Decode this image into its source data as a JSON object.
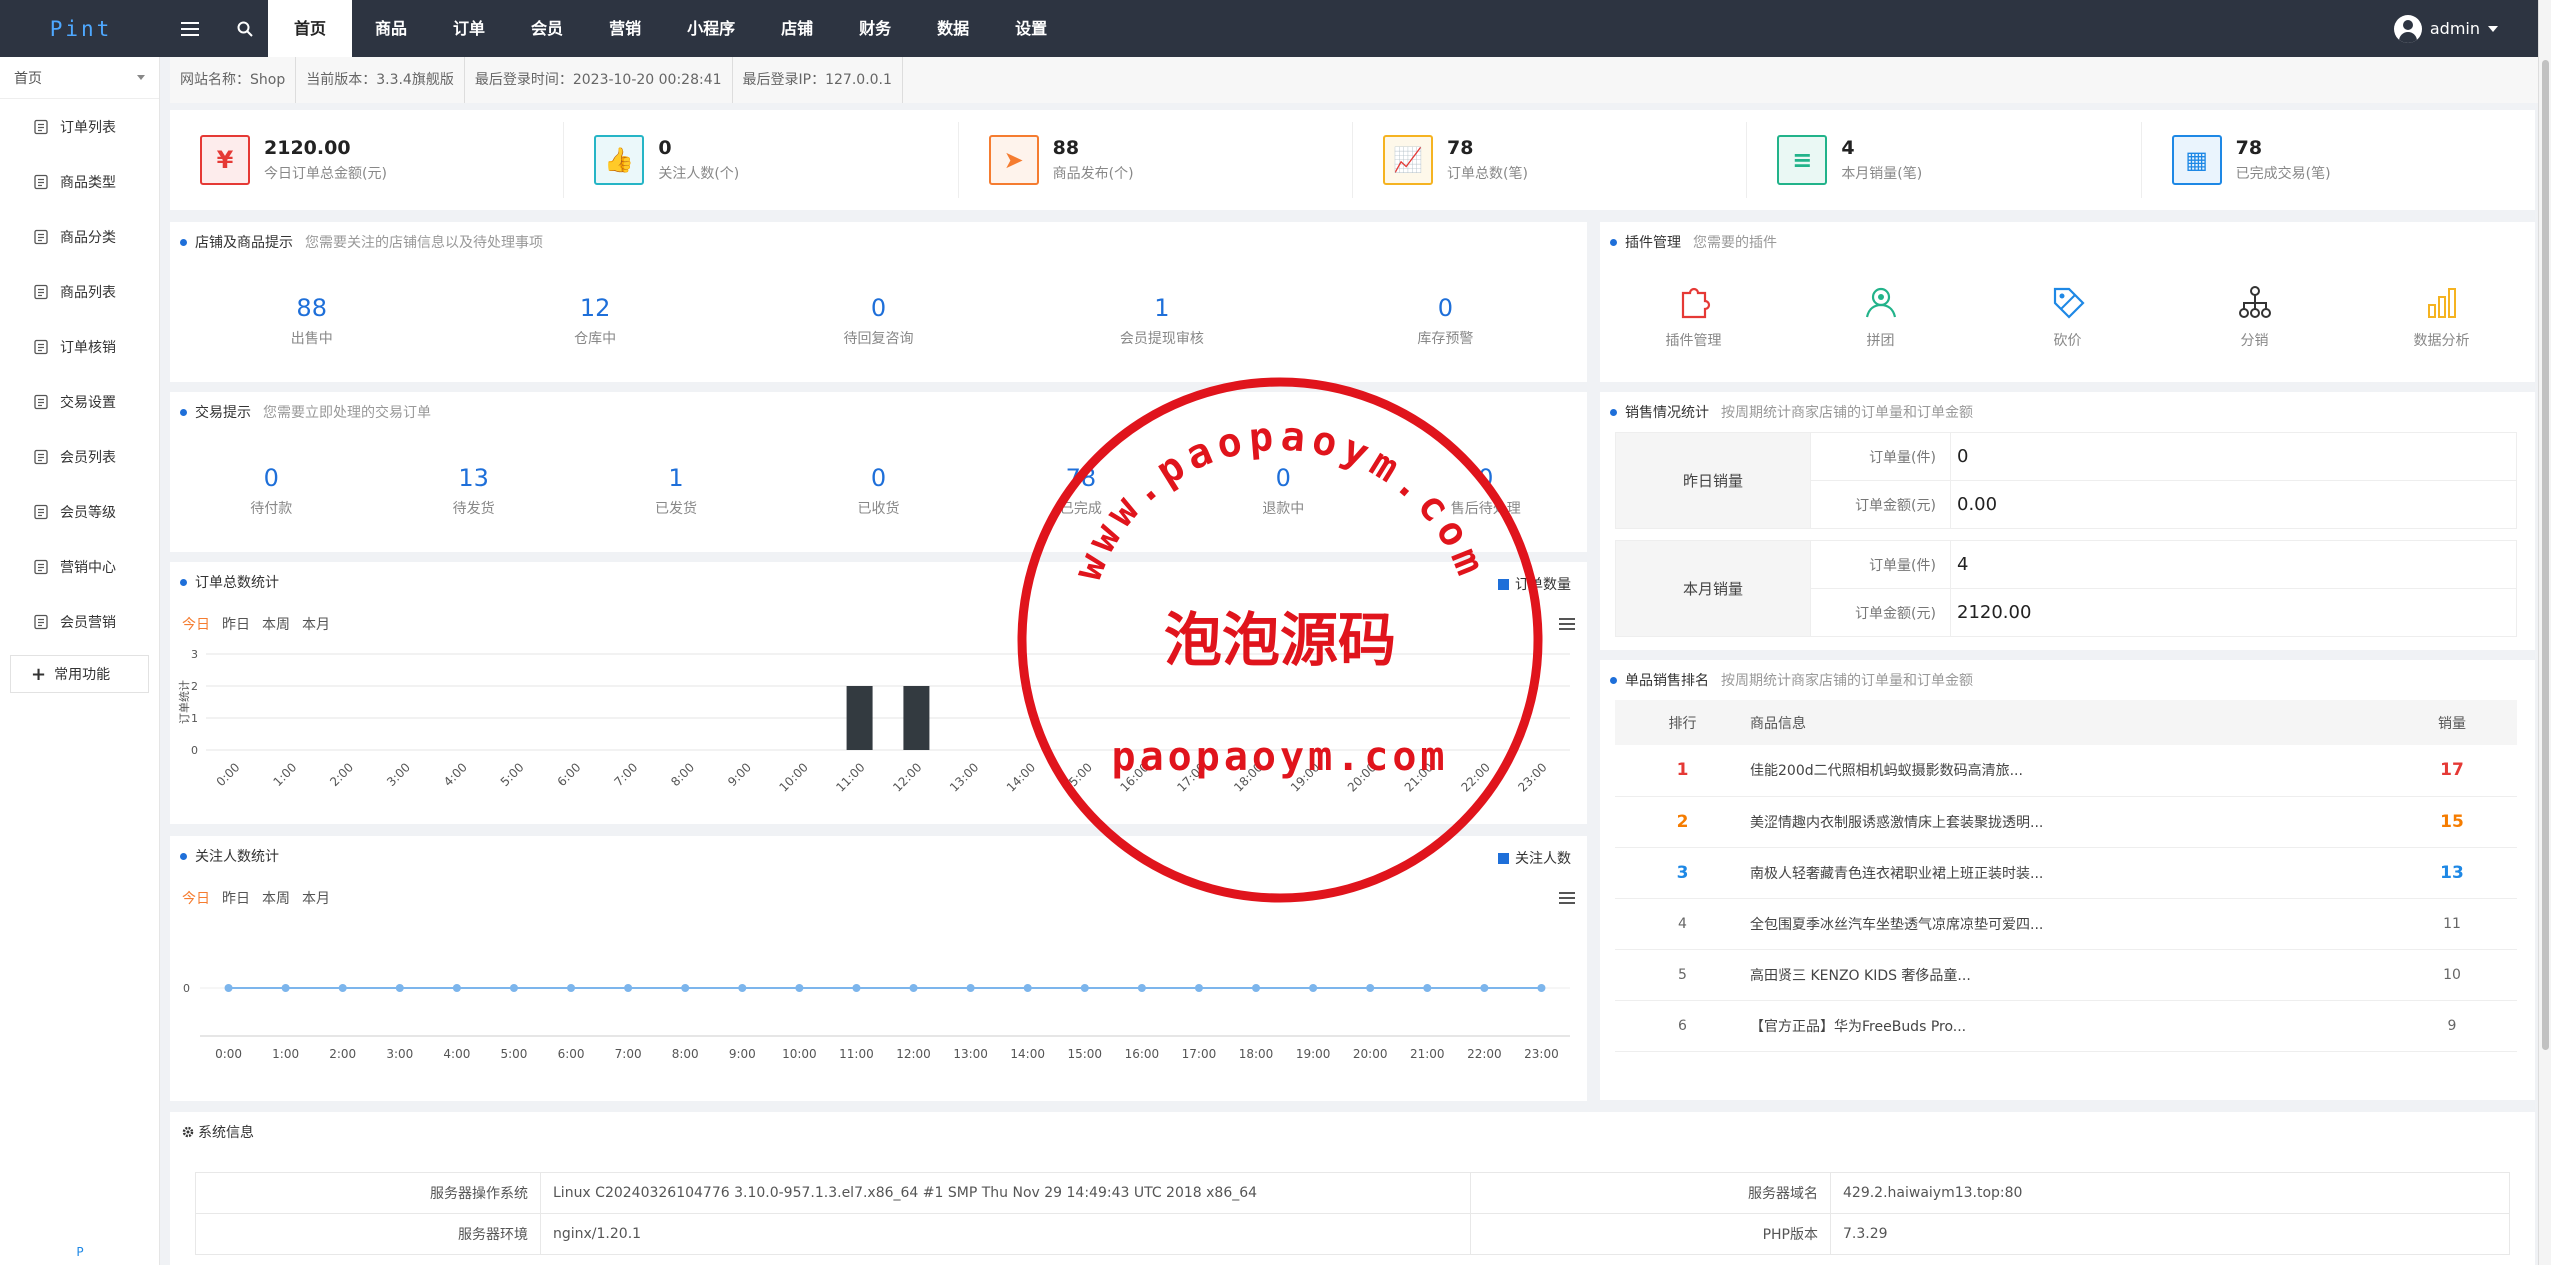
{
  "header": {
    "logo": "Pint",
    "nav": [
      "首页",
      "商品",
      "订单",
      "会员",
      "营销",
      "小程序",
      "店铺",
      "财务",
      "数据",
      "设置"
    ],
    "user": "admin"
  },
  "sidebar": {
    "select": "首页",
    "items": [
      "订单列表",
      "商品类型",
      "商品分类",
      "商品列表",
      "订单核销",
      "交易设置",
      "会员列表",
      "会员等级",
      "营销中心",
      "会员营销"
    ],
    "common": "常用功能",
    "bottom": "P"
  },
  "info": {
    "site": "网站名称：Shop",
    "version": "当前版本：3.3.4旗舰版",
    "last_login": "最后登录时间：2023-10-20 00:28:41",
    "last_ip": "最后登录IP：127.0.0.1"
  },
  "stats": [
    {
      "value": "2120.00",
      "label": "今日订单总金额(元)",
      "color": "#e53935",
      "icon": "yen-icon"
    },
    {
      "value": "0",
      "label": "关注人数(个)",
      "color": "#26b5c6",
      "icon": "thumbs-up-icon"
    },
    {
      "value": "88",
      "label": "商品发布(个)",
      "color": "#f57c30",
      "icon": "paper-plane-icon"
    },
    {
      "value": "78",
      "label": "订单总数(笔)",
      "color": "#f5b321",
      "icon": "trend-chart-icon"
    },
    {
      "value": "4",
      "label": "本月销量(笔)",
      "color": "#22b38a",
      "icon": "clipboard-icon"
    },
    {
      "value": "78",
      "label": "已完成交易(笔)",
      "color": "#1e88e5",
      "icon": "calendar-icon"
    }
  ],
  "store": {
    "title": "店铺及商品提示",
    "subtitle": "您需要关注的店铺信息以及待处理事项",
    "metrics": [
      {
        "value": "88",
        "label": "出售中"
      },
      {
        "value": "12",
        "label": "仓库中"
      },
      {
        "value": "0",
        "label": "待回复咨询"
      },
      {
        "value": "1",
        "label": "会员提现审核"
      },
      {
        "value": "0",
        "label": "库存预警"
      }
    ]
  },
  "trade": {
    "title": "交易提示",
    "subtitle": "您需要立即处理的交易订单",
    "metrics": [
      {
        "value": "0",
        "label": "待付款"
      },
      {
        "value": "13",
        "label": "待发货"
      },
      {
        "value": "1",
        "label": "已发货"
      },
      {
        "value": "0",
        "label": "已收货"
      },
      {
        "value": "78",
        "label": "已完成"
      },
      {
        "value": "0",
        "label": "退款中"
      },
      {
        "value": "0",
        "label": "售后待处理"
      }
    ]
  },
  "plugins": {
    "title": "插件管理",
    "subtitle": "您需要的插件",
    "items": [
      {
        "label": "插件管理",
        "color": "#e53935",
        "icon": "puzzle-icon"
      },
      {
        "label": "拼团",
        "color": "#22b38a",
        "icon": "group-icon"
      },
      {
        "label": "砍价",
        "color": "#1e88e5",
        "icon": "price-tag-icon"
      },
      {
        "label": "分销",
        "color": "#333333",
        "icon": "distribution-icon"
      },
      {
        "label": "数据分析",
        "color": "#f5b321",
        "icon": "bar-chart-icon"
      }
    ]
  },
  "sales": {
    "title": "销售情况统计",
    "subtitle": "按周期统计商家店铺的订单量和订单金额",
    "groups": [
      {
        "name": "昨日销量",
        "rows": [
          {
            "label": "订单量(件)",
            "value": "0"
          },
          {
            "label": "订单金额(元)",
            "value": "0.00"
          }
        ]
      },
      {
        "name": "本月销量",
        "rows": [
          {
            "label": "订单量(件)",
            "value": "4"
          },
          {
            "label": "订单金额(元)",
            "value": "2120.00"
          }
        ]
      }
    ]
  },
  "ranking": {
    "title": "单品销售排名",
    "subtitle": "按周期统计商家店铺的订单量和订单金额",
    "headers": [
      "排行",
      "商品信息",
      "销量"
    ],
    "rows": [
      {
        "rank": "1",
        "name": "佳能200d二代照相机蚂蚁摄影数码高清旅...",
        "sales": "17",
        "color": "#e53935"
      },
      {
        "rank": "2",
        "name": "美涩情趣内衣制服诱惑激情床上套装聚拢透明...",
        "sales": "15",
        "color": "#f57c00"
      },
      {
        "rank": "3",
        "name": "南极人轻奢藏青色连衣裙职业裙上班正装时装...",
        "sales": "13",
        "color": "#1e88e5"
      },
      {
        "rank": "4",
        "name": "全包围夏季冰丝汽车坐垫透气凉席凉垫可爱四...",
        "sales": "11",
        "color": "#666666"
      },
      {
        "rank": "5",
        "name": "高田贤三 KENZO KIDS 奢侈品童...",
        "sales": "10",
        "color": "#666666"
      },
      {
        "rank": "6",
        "name": "【官方正品】华为FreeBuds Pro...",
        "sales": "9",
        "color": "#666666"
      }
    ]
  },
  "order_chart": {
    "title": "订单总数统计",
    "tabs": [
      "今日",
      "昨日",
      "本周",
      "本月"
    ],
    "legend": "订单数量"
  },
  "follow_chart": {
    "title": "关注人数统计",
    "tabs": [
      "今日",
      "昨日",
      "本周",
      "本月"
    ],
    "legend": "关注人数"
  },
  "chart_data": [
    {
      "type": "bar",
      "ylabel": "订单统计",
      "categories": [
        "0:00",
        "1:00",
        "2:00",
        "3:00",
        "4:00",
        "5:00",
        "6:00",
        "7:00",
        "8:00",
        "9:00",
        "10:00",
        "11:00",
        "12:00",
        "13:00",
        "14:00",
        "15:00",
        "16:00",
        "17:00",
        "18:00",
        "19:00",
        "20:00",
        "21:00",
        "22:00",
        "23:00"
      ],
      "series": [
        {
          "name": "订单数量",
          "values": [
            0,
            0,
            0,
            0,
            0,
            0,
            0,
            0,
            0,
            0,
            0,
            2,
            2,
            0,
            0,
            0,
            0,
            0,
            0,
            0,
            0,
            0,
            0,
            0
          ]
        }
      ],
      "ylim": [
        0,
        3
      ],
      "yticks": [
        "0",
        "1",
        "2",
        "3"
      ],
      "color": "#333a40",
      "grid": true
    },
    {
      "type": "line",
      "categories": [
        "0:00",
        "1:00",
        "2:00",
        "3:00",
        "4:00",
        "5:00",
        "6:00",
        "7:00",
        "8:00",
        "9:00",
        "10:00",
        "11:00",
        "12:00",
        "13:00",
        "14:00",
        "15:00",
        "16:00",
        "17:00",
        "18:00",
        "19:00",
        "20:00",
        "21:00",
        "22:00",
        "23:00"
      ],
      "series": [
        {
          "name": "关注人数",
          "values": [
            0,
            0,
            0,
            0,
            0,
            0,
            0,
            0,
            0,
            0,
            0,
            0,
            0,
            0,
            0,
            0,
            0,
            0,
            0,
            0,
            0,
            0,
            0,
            0
          ]
        }
      ],
      "yticks": [
        "0"
      ],
      "color": "#7cb5ec",
      "grid": true
    }
  ],
  "system": {
    "title": "系统信息",
    "rows": [
      {
        "k1": "服务器操作系统",
        "v1": "Linux C20240326104776 3.10.0-957.1.3.el7.x86_64 #1 SMP Thu Nov 29 14:49:43 UTC 2018 x86_64",
        "k2": "服务器域名",
        "v2": "429.2.haiwaiym13.top:80"
      },
      {
        "k1": "服务器环境",
        "v1": "nginx/1.20.1",
        "k2": "PHP版本",
        "v2": "7.3.29"
      }
    ]
  },
  "watermark": {
    "arc": "www.paopaoym.com",
    "center": "泡泡源码",
    "bottom": "paopaoym.com",
    "color": "#e0141c"
  }
}
